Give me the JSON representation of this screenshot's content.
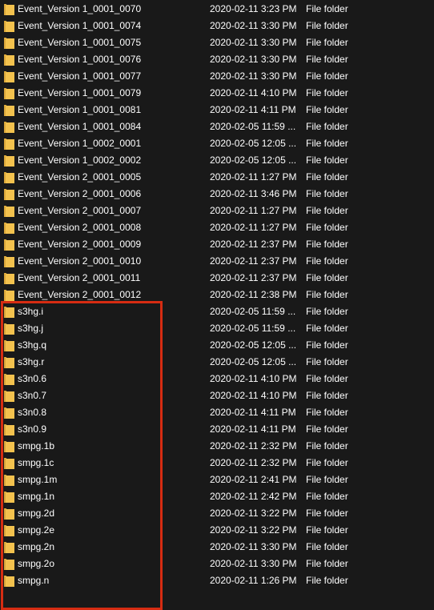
{
  "colors": {
    "background": "#191919",
    "text": "#ffffff",
    "folder_icon": "#f3c24e",
    "highlight_box": "#d62c12"
  },
  "icons": {
    "row_icon": "folder-icon"
  },
  "files": [
    {
      "name": "Event_Version 1_0001_0070",
      "date": "2020-02-11 3:23 PM",
      "type": "File folder"
    },
    {
      "name": "Event_Version 1_0001_0074",
      "date": "2020-02-11 3:30 PM",
      "type": "File folder"
    },
    {
      "name": "Event_Version 1_0001_0075",
      "date": "2020-02-11 3:30 PM",
      "type": "File folder"
    },
    {
      "name": "Event_Version 1_0001_0076",
      "date": "2020-02-11 3:30 PM",
      "type": "File folder"
    },
    {
      "name": "Event_Version 1_0001_0077",
      "date": "2020-02-11 3:30 PM",
      "type": "File folder"
    },
    {
      "name": "Event_Version 1_0001_0079",
      "date": "2020-02-11 4:10 PM",
      "type": "File folder"
    },
    {
      "name": "Event_Version 1_0001_0081",
      "date": "2020-02-11 4:11 PM",
      "type": "File folder"
    },
    {
      "name": "Event_Version 1_0001_0084",
      "date": "2020-02-05 11:59 ...",
      "type": "File folder"
    },
    {
      "name": "Event_Version 1_0002_0001",
      "date": "2020-02-05 12:05 ...",
      "type": "File folder"
    },
    {
      "name": "Event_Version 1_0002_0002",
      "date": "2020-02-05 12:05 ...",
      "type": "File folder"
    },
    {
      "name": "Event_Version 2_0001_0005",
      "date": "2020-02-11 1:27 PM",
      "type": "File folder"
    },
    {
      "name": "Event_Version 2_0001_0006",
      "date": "2020-02-11 3:46 PM",
      "type": "File folder"
    },
    {
      "name": "Event_Version 2_0001_0007",
      "date": "2020-02-11 1:27 PM",
      "type": "File folder"
    },
    {
      "name": "Event_Version 2_0001_0008",
      "date": "2020-02-11 1:27 PM",
      "type": "File folder"
    },
    {
      "name": "Event_Version 2_0001_0009",
      "date": "2020-02-11 2:37 PM",
      "type": "File folder"
    },
    {
      "name": "Event_Version 2_0001_0010",
      "date": "2020-02-11 2:37 PM",
      "type": "File folder"
    },
    {
      "name": "Event_Version 2_0001_0011",
      "date": "2020-02-11 2:37 PM",
      "type": "File folder"
    },
    {
      "name": "Event_Version 2_0001_0012",
      "date": "2020-02-11 2:38 PM",
      "type": "File folder"
    },
    {
      "name": "s3hg.i",
      "date": "2020-02-05 11:59 ...",
      "type": "File folder"
    },
    {
      "name": "s3hg.j",
      "date": "2020-02-05 11:59 ...",
      "type": "File folder"
    },
    {
      "name": "s3hg.q",
      "date": "2020-02-05 12:05 ...",
      "type": "File folder"
    },
    {
      "name": "s3hg.r",
      "date": "2020-02-05 12:05 ...",
      "type": "File folder"
    },
    {
      "name": "s3n0.6",
      "date": "2020-02-11 4:10 PM",
      "type": "File folder"
    },
    {
      "name": "s3n0.7",
      "date": "2020-02-11 4:10 PM",
      "type": "File folder"
    },
    {
      "name": "s3n0.8",
      "date": "2020-02-11 4:11 PM",
      "type": "File folder"
    },
    {
      "name": "s3n0.9",
      "date": "2020-02-11 4:11 PM",
      "type": "File folder"
    },
    {
      "name": "smpg.1b",
      "date": "2020-02-11 2:32 PM",
      "type": "File folder"
    },
    {
      "name": "smpg.1c",
      "date": "2020-02-11 2:32 PM",
      "type": "File folder"
    },
    {
      "name": "smpg.1m",
      "date": "2020-02-11 2:41 PM",
      "type": "File folder"
    },
    {
      "name": "smpg.1n",
      "date": "2020-02-11 2:42 PM",
      "type": "File folder"
    },
    {
      "name": "smpg.2d",
      "date": "2020-02-11 3:22 PM",
      "type": "File folder"
    },
    {
      "name": "smpg.2e",
      "date": "2020-02-11 3:22 PM",
      "type": "File folder"
    },
    {
      "name": "smpg.2n",
      "date": "2020-02-11 3:30 PM",
      "type": "File folder"
    },
    {
      "name": "smpg.2o",
      "date": "2020-02-11 3:30 PM",
      "type": "File folder"
    },
    {
      "name": "smpg.n",
      "date": "2020-02-11 1:26 PM",
      "type": "File folder"
    }
  ]
}
